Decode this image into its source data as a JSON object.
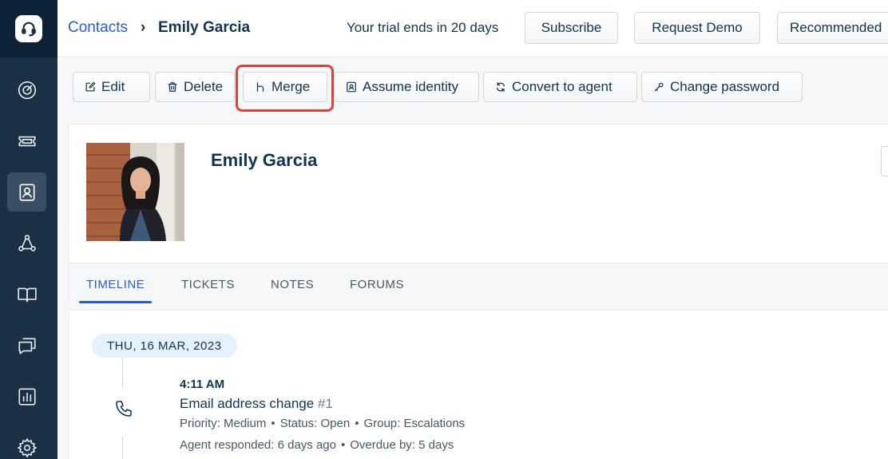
{
  "breadcrumb": {
    "parent": "Contacts",
    "separator": "›",
    "current": "Emily Garcia"
  },
  "header": {
    "trial_text": "Your trial ends in 20 days",
    "subscribe_label": "Subscribe",
    "request_demo_label": "Request Demo",
    "recommended_label": "Recommended"
  },
  "toolbar": {
    "edit_label": "Edit",
    "delete_label": "Delete",
    "merge_label": "Merge",
    "assume_identity_label": "Assume identity",
    "convert_to_agent_label": "Convert to agent",
    "change_password_label": "Change password"
  },
  "contact": {
    "name": "Emily Garcia"
  },
  "tabs": [
    {
      "label": "TIMELINE",
      "active": true
    },
    {
      "label": "TICKETS",
      "active": false
    },
    {
      "label": "NOTES",
      "active": false
    },
    {
      "label": "FORUMS",
      "active": false
    }
  ],
  "timeline": {
    "date": "THU, 16 MAR, 2023",
    "event": {
      "time": "4:11 AM",
      "icon": "phone-icon",
      "subject": "Email address change",
      "ticket_id": "#1",
      "priority": "Priority: Medium",
      "status": "Status: Open",
      "group": "Group: Escalations",
      "agent_responded": "Agent responded: 6 days ago",
      "overdue": "Overdue by: 5 days"
    }
  },
  "sidebar": {
    "items": [
      {
        "icon": "dashboard-icon",
        "active": false
      },
      {
        "icon": "tickets-icon",
        "active": false
      },
      {
        "icon": "contacts-icon",
        "active": true
      },
      {
        "icon": "social-icon",
        "active": false
      },
      {
        "icon": "solutions-icon",
        "active": false
      },
      {
        "icon": "forums-icon",
        "active": false
      },
      {
        "icon": "reports-icon",
        "active": false
      },
      {
        "icon": "admin-icon",
        "active": false
      }
    ]
  },
  "colors": {
    "sidebar": "#1b2f45",
    "accent": "#2c5cc5",
    "highlight": "#d9453a",
    "date_pill": "#e5f2fd"
  }
}
